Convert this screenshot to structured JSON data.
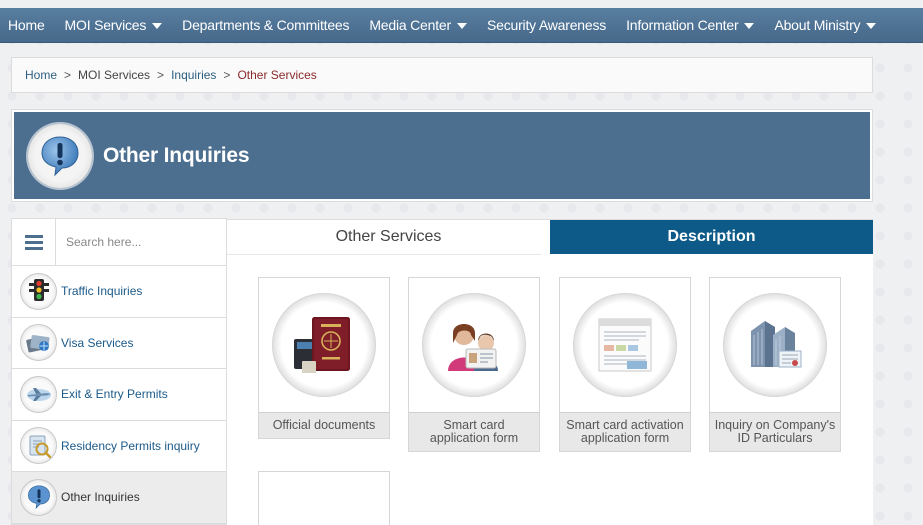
{
  "nav": {
    "items": [
      {
        "label": "Home",
        "has_dropdown": false
      },
      {
        "label": "MOI Services",
        "has_dropdown": true
      },
      {
        "label": "Departments & Committees",
        "has_dropdown": false
      },
      {
        "label": "Media Center",
        "has_dropdown": true
      },
      {
        "label": "Security Awareness",
        "has_dropdown": false
      },
      {
        "label": "Information Center",
        "has_dropdown": true
      },
      {
        "label": "About Ministry",
        "has_dropdown": true
      }
    ]
  },
  "breadcrumb": {
    "home": "Home",
    "services": "MOI Services",
    "inquiries": "Inquiries",
    "current": "Other Services",
    "separator": ">"
  },
  "banner": {
    "title": "Other Inquiries",
    "icon": "exclamation-icon"
  },
  "sidebar": {
    "search_placeholder": "Search here...",
    "items": [
      {
        "label": "Traffic Inquiries",
        "icon": "traffic-light-icon",
        "active": false
      },
      {
        "label": "Visa Services",
        "icon": "visa-icon",
        "active": false
      },
      {
        "label": "Exit & Entry Permits",
        "icon": "airplane-icon",
        "active": false
      },
      {
        "label": "Residency Permits inquiry",
        "icon": "residency-icon",
        "active": false
      },
      {
        "label": "Other Inquiries",
        "icon": "exclamation-icon",
        "active": true
      }
    ]
  },
  "tabs": {
    "other_services": "Other Services",
    "description": "Description"
  },
  "cards": [
    {
      "label": "Official documents",
      "icon": "passport-icon"
    },
    {
      "label": "Smart card application form",
      "icon": "smart-card-icon"
    },
    {
      "label": "Smart card activation application form",
      "icon": "form-document-icon"
    },
    {
      "label": "Inquiry on Company's ID Particulars",
      "icon": "company-building-icon"
    }
  ],
  "colors": {
    "nav_bg": "#4f7396",
    "banner_bg": "#4c6e8f",
    "tab_active": "#0d5a88",
    "link": "#1c5a8a",
    "breadcrumb_current": "#8b2a2a"
  }
}
